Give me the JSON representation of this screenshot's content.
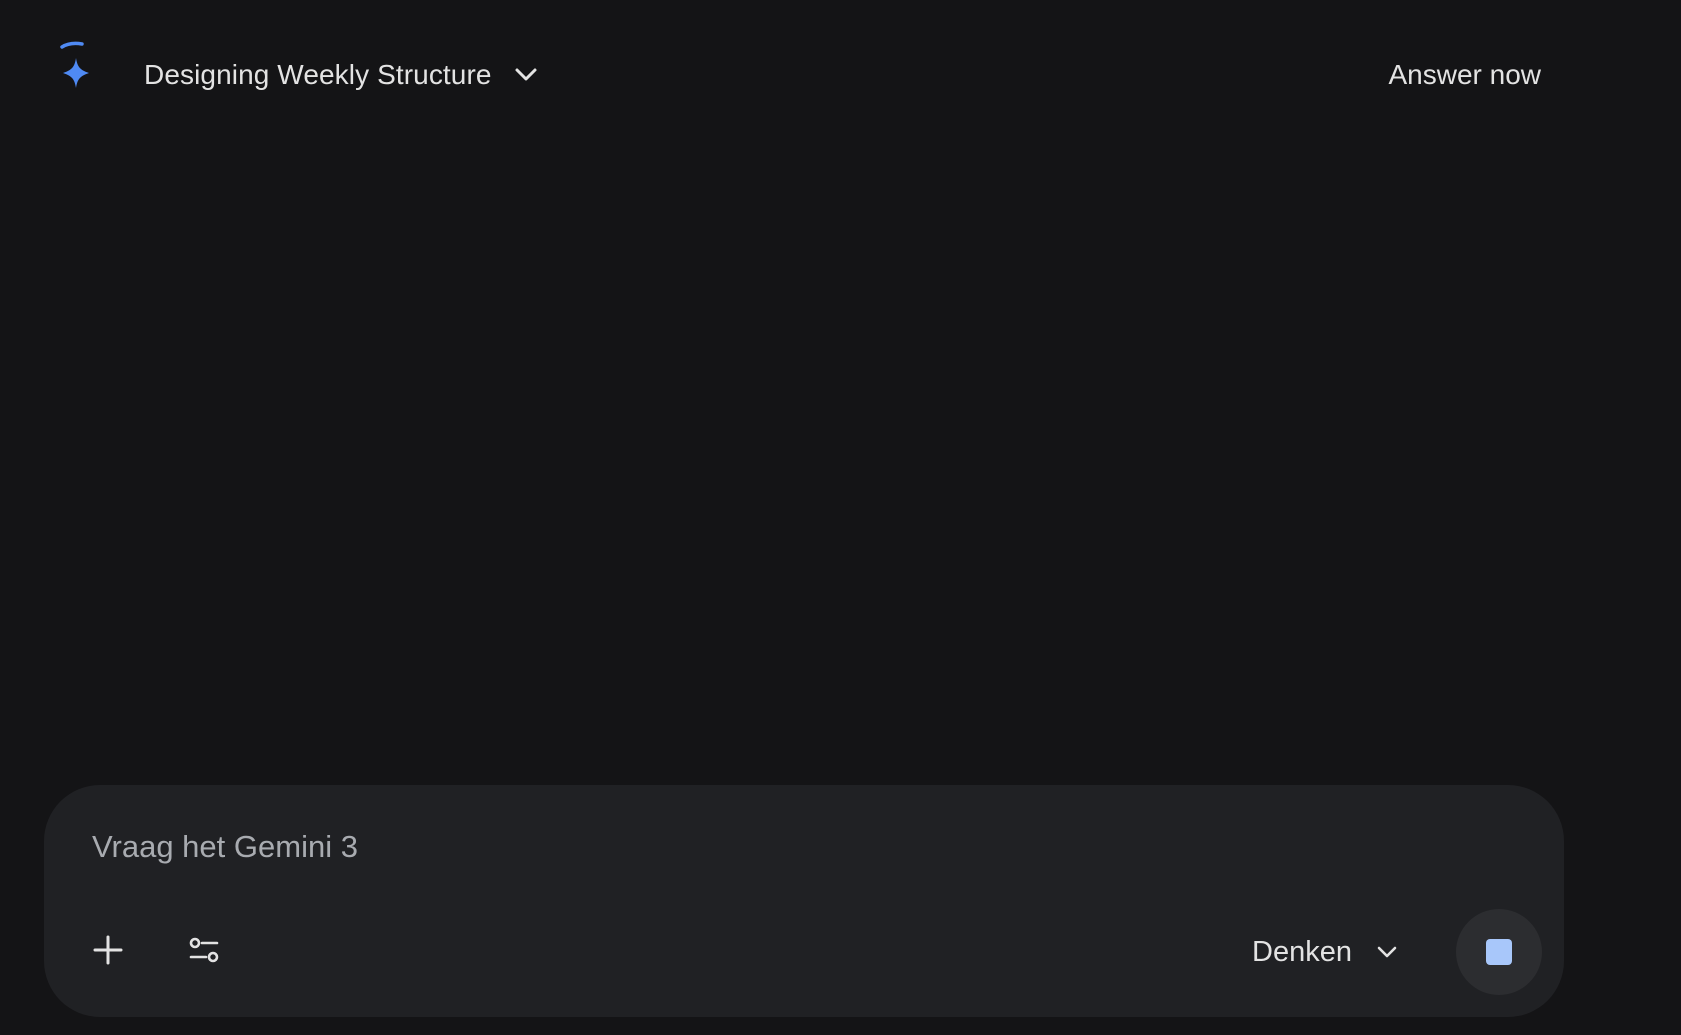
{
  "header": {
    "conversation_title": "Designing Weekly Structure",
    "answer_now_label": "Answer now",
    "icons": {
      "logo": "gemini-sparkle-icon",
      "title_dropdown": "chevron-down-icon"
    }
  },
  "prompt": {
    "placeholder": "Vraag het Gemini 3",
    "value": "",
    "mode_label": "Denken",
    "icons": {
      "add": "plus-icon",
      "tools": "tools-sliders-icon",
      "mode_dropdown": "chevron-down-icon",
      "stop": "stop-icon"
    }
  },
  "colors": {
    "background": "#141416",
    "prompt_box": "#202124",
    "text": "#e3e3e3",
    "placeholder": "#a8abb0",
    "accent_blue": "#4f8af3",
    "stop_fill": "#a8c7fa",
    "stop_button_bg": "#2c2d30"
  }
}
